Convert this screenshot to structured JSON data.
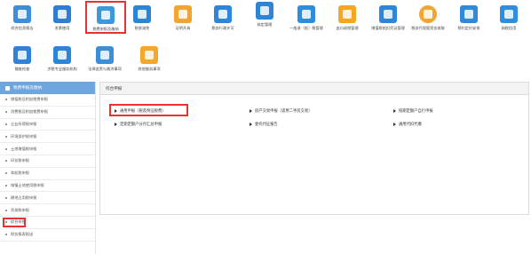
{
  "toolbar": {
    "row1": [
      {
        "label": "综合信息报告",
        "color": "#3f8fd8",
        "icon": "report-icon"
      },
      {
        "label": "发票使用",
        "color": "#2e7fd3",
        "icon": "invoice-icon"
      },
      {
        "label": "税费申报及缴纳",
        "color": "#3a9ad9",
        "icon": "tax-declare-icon"
      },
      {
        "label": "税收减免",
        "color": "#2c86d6",
        "icon": "tax-relief-icon"
      },
      {
        "label": "证明开具",
        "color": "#f4a531",
        "icon": "certificate-icon"
      },
      {
        "label": "税务行政许可",
        "color": "#2e86d9",
        "icon": "permit-icon"
      },
      {
        "label": "核定管理",
        "color": "#2f84d6",
        "icon": "chart-icon"
      },
      {
        "label": "一般退（抵）税管理",
        "color": "#2f8edb",
        "icon": "refund-icon"
      },
      {
        "label": "出口退税管理",
        "color": "#f5a623",
        "icon": "export-icon"
      },
      {
        "label": "增值税抵扣凭证管理",
        "color": "#2d86d8",
        "icon": "vat-icon"
      },
      {
        "label": "税务代保管资金收取",
        "color": "#f2a530",
        "icon": "fund-icon"
      },
      {
        "label": "预约定价安排",
        "color": "#3089db",
        "icon": "schedule-icon"
      },
      {
        "label": "纳税信用",
        "color": "#2f8fdd",
        "icon": "credit-icon"
      }
    ],
    "row2": [
      {
        "label": "稽查检查",
        "color": "#2e83d6",
        "icon": "inspect-icon"
      },
      {
        "label": "涉税专业服务机构",
        "color": "#2c86d8",
        "icon": "agency-icon"
      },
      {
        "label": "法律追责与救济事项",
        "color": "#3b8fd9",
        "icon": "legal-icon"
      },
      {
        "label": "其他服务事项",
        "color": "#f3a82c",
        "icon": "other-icon"
      }
    ]
  },
  "sidebar": {
    "title": "税费申报及缴纳",
    "items": [
      "增值税及附加税费申报",
      "消费税及附加税费申报",
      "企业所得税申报",
      "环境保护税申报",
      "土地增值税申报",
      "印花税申报",
      "车船税申报",
      "城镇土地使用税申报",
      "耕地占用税申报",
      "资源税申报",
      "综合申报",
      "财务报表报送"
    ]
  },
  "main": {
    "panel_title": "综合申报",
    "links": [
      "通用申报（税及附征税费）",
      "房产交易申报（适用二手房交易）",
      "按期定额户自行申报",
      "定期定额户分月汇总申报",
      "委托代征报告",
      "通用代扣代缴"
    ]
  }
}
